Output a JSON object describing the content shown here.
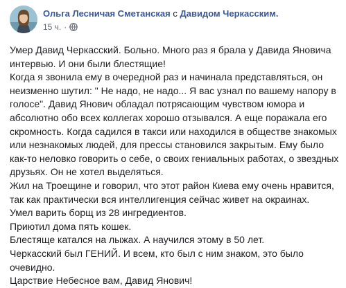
{
  "post": {
    "author": "Ольга Лесничая Сметанская",
    "with_word": "с",
    "tagged": "Давидом Черкасским.",
    "time": "15 ч.",
    "separator": "·",
    "privacy_icon": "globe-icon",
    "paragraphs": [
      "Умер Давид Черкасский. Больно. Много раз я брала у Давида Яновича интервью. И они были блестящие!",
      "Когда я звонила ему в очередной раз и начинала представляться, он неизменно шутил: \" Не надо, не надо... Я вас узнал по вашему напору в голосе\". Давид Янович обладал потрясающим чувством юмора и абсолютно обо всех коллегах хорошо отзывался. А еще поражала его скромность. Когда садился в такси или находился в обществе знакомых или незнакомых людей, для прессы становился закрытым. Ему было как-то неловко говорить о себе, о своих гениальных работах, о звездных друзьях. Он не хотел выделяться.",
      "Жил на Троещине и говорил, что этот район Киева ему очень нравится, так как практически вся интеллигенция сейчас живет на окраинах.",
      "Умел варить борщ из 28 ингредиентов.",
      "Приютил дома пять кошек.",
      "Блестяще катался на лыжах. А научился этому в 50 лет.",
      "Черкасский был ГЕНИЙ. И всем, кто был с ним знаком, это было очевидно.",
      "Царствие Небесное вам, Давид Янович!"
    ]
  },
  "colors": {
    "link": "#385898",
    "text": "#1c1e21",
    "meta": "#616770"
  }
}
